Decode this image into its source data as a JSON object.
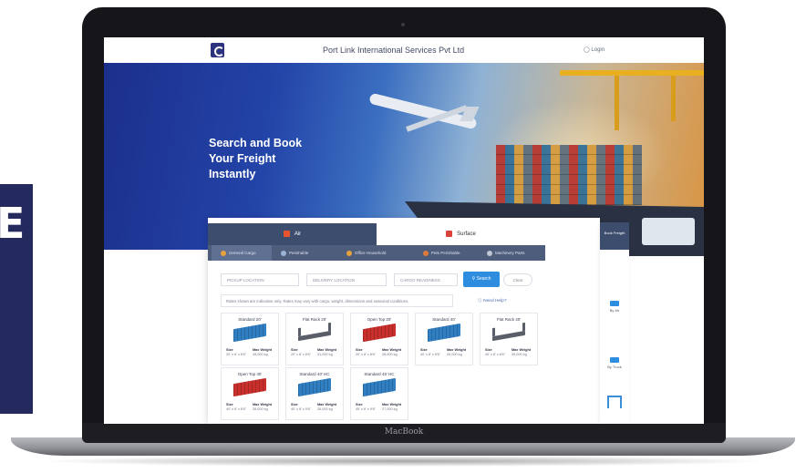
{
  "brand_side_text": "E",
  "device_label": "MacBook",
  "site": {
    "company_name": "Port Link International Services Pvt Ltd",
    "login_label": "Login"
  },
  "hero": {
    "title_line1": "Search and Book",
    "title_line2": "Your Freight",
    "title_line3": "Instantly"
  },
  "mode_tabs": [
    {
      "label": "Air",
      "active": true
    },
    {
      "label": "Surface",
      "active": false
    }
  ],
  "categories": [
    {
      "label": "General Cargo",
      "active": true
    },
    {
      "label": "Perishable",
      "active": false
    },
    {
      "label": "Office Household",
      "active": false
    },
    {
      "label": "Pets Perishable",
      "active": false
    },
    {
      "label": "Machinery Parts",
      "active": false
    }
  ],
  "search": {
    "pickup_placeholder": "PICKUP LOCATION",
    "delivery_placeholder": "DELIVERY LOCATION",
    "date_placeholder": "CARGO READINESS",
    "search_label": "Search",
    "clear_label": "Clear"
  },
  "notice_text": "Rates shown are indicative only. Rates may vary with cargo, weight, dimensions and seasonal conditions.",
  "help_label": "Need Help?",
  "containers": [
    {
      "name": "Standard 20'",
      "color": "#2f7fc2",
      "type": "box",
      "size": "Size",
      "max_weight": "Max Weight",
      "size_val": "20' x 8' x 8'6\"",
      "weight_val": "28,000 kg"
    },
    {
      "name": "Flat Rack 20'",
      "color": "#5a5e68",
      "type": "flat",
      "size": "Size",
      "max_weight": "Max Weight",
      "size_val": "20' x 8' x 8'6\"",
      "weight_val": "31,000 kg"
    },
    {
      "name": "Open Top 20'",
      "color": "#c9302c",
      "type": "box",
      "size": "Size",
      "max_weight": "Max Weight",
      "size_val": "20' x 8' x 8'6\"",
      "weight_val": "28,000 kg"
    },
    {
      "name": "Standard 40'",
      "color": "#2f7fc2",
      "type": "box",
      "size": "Size",
      "max_weight": "Max Weight",
      "size_val": "40' x 8' x 8'6\"",
      "weight_val": "26,000 kg"
    },
    {
      "name": "Flat Rack 40'",
      "color": "#5a5e68",
      "type": "flat",
      "size": "Size",
      "max_weight": "Max Weight",
      "size_val": "40' x 8' x 8'6\"",
      "weight_val": "39,000 kg"
    },
    {
      "name": "Open Top 40'",
      "color": "#c9302c",
      "type": "box",
      "size": "Size",
      "max_weight": "Max Weight",
      "size_val": "40' x 8' x 8'6\"",
      "weight_val": "26,000 kg"
    },
    {
      "name": "Standard 40' HC",
      "color": "#2f7fc2",
      "type": "box",
      "size": "Size",
      "max_weight": "Max Weight",
      "size_val": "40' x 8' x 9'6\"",
      "weight_val": "26,000 kg"
    },
    {
      "name": "Standard 45' HC",
      "color": "#2f7fc2",
      "type": "box",
      "size": "Size",
      "max_weight": "Max Weight",
      "size_val": "45' x 8' x 9'6\"",
      "weight_val": "27,000 kg"
    }
  ],
  "rail": {
    "top_label": "Book Freight",
    "item1": "By Air",
    "item2": "By Truck"
  }
}
